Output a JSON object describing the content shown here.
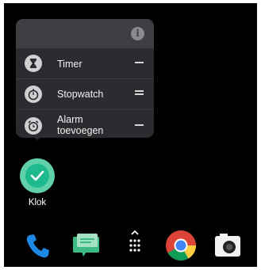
{
  "popup": {
    "shortcuts": [
      {
        "label": "Timer",
        "icon": "hourglass-icon"
      },
      {
        "label": "Stopwatch",
        "icon": "stopwatch-icon"
      },
      {
        "label": "Alarm toevoegen",
        "icon": "alarm-clock-icon"
      }
    ]
  },
  "app": {
    "label": "Klok",
    "color": "#5fd0a8"
  },
  "dock": {
    "items": [
      "phone-icon",
      "messages-icon",
      "app-drawer-icon",
      "chrome-icon",
      "camera-icon"
    ]
  }
}
